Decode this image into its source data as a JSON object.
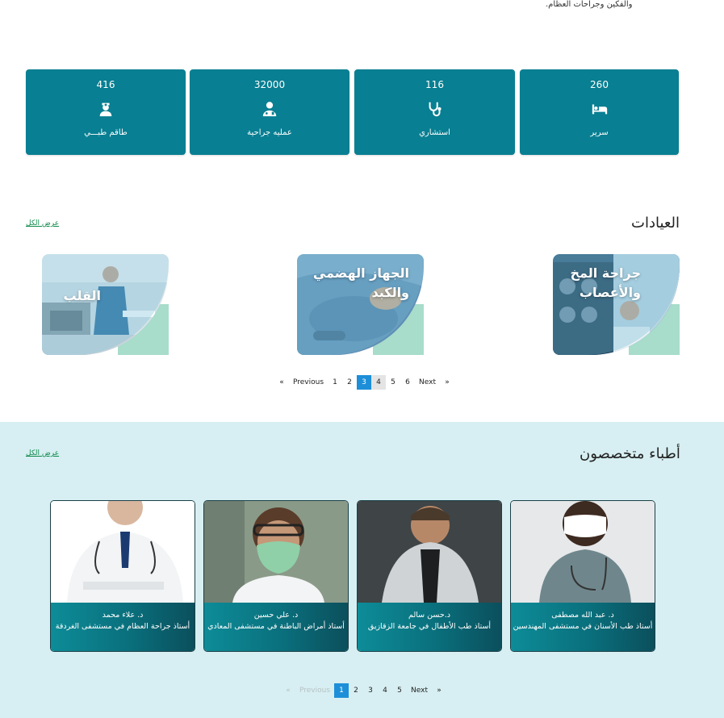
{
  "intro": {
    "text_tail": "والفكين وجراحات العظام."
  },
  "stats": [
    {
      "value": "416",
      "label": "طاقم طبـــي",
      "icon": "nurse-icon"
    },
    {
      "value": "32000",
      "label": "عمليه جراحية",
      "icon": "surgeon-icon"
    },
    {
      "value": "116",
      "label": "استشاري",
      "icon": "stethoscope-icon"
    },
    {
      "value": "260",
      "label": "سرير",
      "icon": "bed-icon"
    }
  ],
  "clinics": {
    "title": "العيادات",
    "see_all": "عرض الكل",
    "items": [
      {
        "title": "القلب"
      },
      {
        "title": "الجهاز الهضمي والكبد"
      },
      {
        "title": "جراحة المخ والأعصاب"
      }
    ],
    "pager": {
      "prev_arrow": "«",
      "prev": "Previous",
      "pages": [
        "1",
        "2",
        "3",
        "4",
        "5",
        "6"
      ],
      "current": "3",
      "next": "Next",
      "next_arrow": "»"
    }
  },
  "doctors": {
    "title": "أطباء متخصصون",
    "see_all": "عرض الكل",
    "items": [
      {
        "name": "د. علاء محمد",
        "role": "أستاذ جراحة العظام في مستشفى الغردقة"
      },
      {
        "name": "د. علي حسين",
        "role": "أستاذ أمراض الباطنة في مستشفى المعادي"
      },
      {
        "name": "د.حسن سالم",
        "role": "أستاذ طب الأطفال في جامعة الزقازيق"
      },
      {
        "name": "د. عبد الله مصطفى",
        "role": "أستاذ طب الأسنان في مستشفى المهندسين"
      }
    ],
    "pager": {
      "prev_arrow": "«",
      "prev": "Previous",
      "pages": [
        "1",
        "2",
        "3",
        "4",
        "5"
      ],
      "current": "1",
      "next": "Next",
      "next_arrow": "»"
    }
  },
  "colors": {
    "teal": "#087f92",
    "mint": "#a8dccb",
    "pager_active": "#1d8fd8",
    "doctors_bg": "#d7eff2"
  }
}
